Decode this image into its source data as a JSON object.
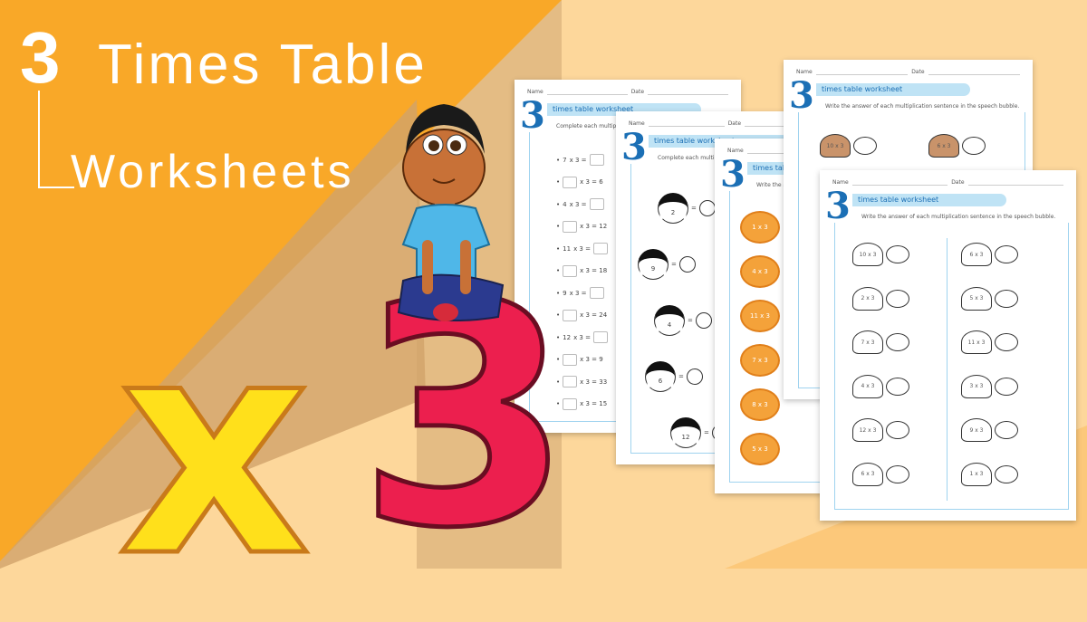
{
  "title": {
    "number": "3",
    "line1": "Times Table",
    "line2": "Worksheets"
  },
  "colors": {
    "orange": "#F9A828",
    "peach": "#FDD79B",
    "red3": "#EC1F4E",
    "yellowX": "#FFE01B",
    "blue": "#1B6FB5"
  },
  "decor": {
    "big_x": "x",
    "big_3": "3"
  },
  "common": {
    "name": "Name",
    "date": "Date",
    "logo": "3",
    "banner": "times table worksheet"
  },
  "worksheet1": {
    "instruction": "Complete each multiplication",
    "rows": [
      {
        "a": "7",
        "b": "x 3 =",
        "c": ""
      },
      {
        "a": "",
        "b": "x 3 = 6",
        "c": null
      },
      {
        "a": "4",
        "b": "x 3 =",
        "c": ""
      },
      {
        "a": "",
        "b": "x 3 = 12",
        "c": null
      },
      {
        "a": "11",
        "b": "x 3 =",
        "c": ""
      },
      {
        "a": "",
        "b": "x 3 = 18",
        "c": null
      },
      {
        "a": "9",
        "b": "x 3 =",
        "c": ""
      },
      {
        "a": "",
        "b": "x 3 = 24",
        "c": null
      },
      {
        "a": "12",
        "b": "x 3 =",
        "c": ""
      },
      {
        "a": "",
        "b": "x 3 = 9",
        "c": null
      },
      {
        "a": "",
        "b": "x 3 = 33",
        "c": null
      },
      {
        "a": "",
        "b": "x 3 = 15",
        "c": null
      }
    ]
  },
  "worksheet2": {
    "instruction": "Complete each multiplication",
    "ladybugs": [
      "2",
      "9",
      "4",
      "6",
      "12"
    ]
  },
  "worksheet3": {
    "instruction": "Write the answer",
    "snails": [
      "1 x 3",
      "4 x 3",
      "11 x 3",
      "7 x 3",
      "8 x 3",
      "5 x 3"
    ]
  },
  "worksheet4": {
    "instruction": "Write the answer of each multiplication sentence in the speech bubble.",
    "turtles": [
      "10 x 3",
      "6 x 3"
    ]
  },
  "worksheet5": {
    "instruction": "Write the answer of each multiplication sentence in the speech bubble.",
    "left": [
      "10 x 3",
      "2 x 3",
      "7 x 3",
      "4 x 3",
      "12 x 3",
      "6 x 3"
    ],
    "right": [
      "6 x 3",
      "5 x 3",
      "11 x 3",
      "3 x 3",
      "9 x 3",
      "1 x 3"
    ]
  }
}
